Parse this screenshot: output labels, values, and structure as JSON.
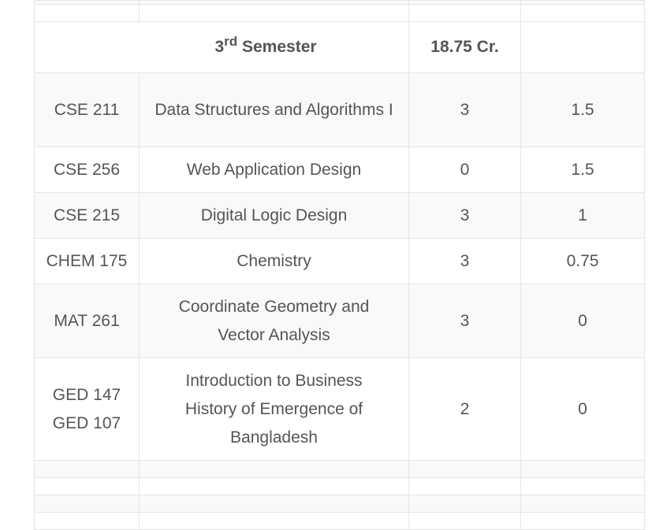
{
  "semester": {
    "number": "3",
    "suffix": "rd",
    "label": "Semester",
    "credits": "18.75 Cr."
  },
  "courses": [
    {
      "code": [
        "CSE 211"
      ],
      "title": "Data Structures and Algorithms I",
      "theory": "3",
      "lab": "1.5"
    },
    {
      "code": [
        "CSE 256"
      ],
      "title": "Web Application Design",
      "theory": "0",
      "lab": "1.5"
    },
    {
      "code": [
        "CSE 215"
      ],
      "title": "Digital Logic Design",
      "theory": "3",
      "lab": "1"
    },
    {
      "code": [
        "CHEM 175"
      ],
      "title": "Chemistry",
      "theory": "3",
      "lab": "0.75"
    },
    {
      "code": [
        "MAT 261"
      ],
      "title": "Coordinate Geometry and Vector Analysis",
      "theory": "3",
      "lab": "0"
    },
    {
      "code": [
        "GED 147",
        "GED 107"
      ],
      "title": "Introduction to Business History of Emergence of Bangladesh",
      "theory": "2",
      "lab": "0"
    }
  ]
}
